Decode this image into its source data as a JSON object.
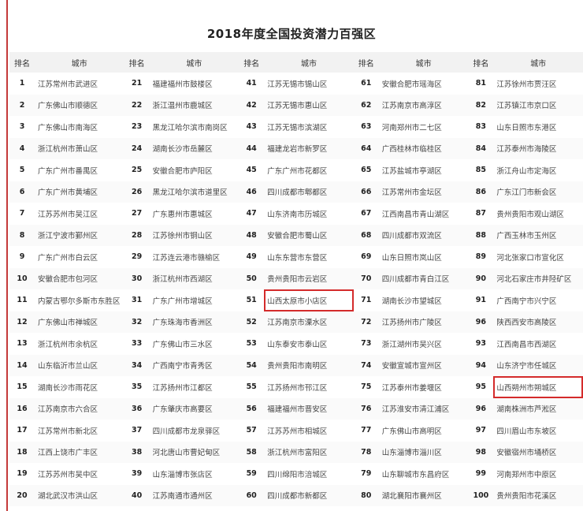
{
  "title": "2018年度全国投资潜力百强区",
  "headers": {
    "rank": "排名",
    "city": "城市"
  },
  "highlight_ranks": [
    51,
    95
  ],
  "rankings": [
    {
      "rank": 1,
      "name": "江苏常州市武进区"
    },
    {
      "rank": 2,
      "name": "广东佛山市顺德区"
    },
    {
      "rank": 3,
      "name": "广东佛山市南海区"
    },
    {
      "rank": 4,
      "name": "浙江杭州市萧山区"
    },
    {
      "rank": 5,
      "name": "广东广州市番禺区"
    },
    {
      "rank": 6,
      "name": "广东广州市黄埔区"
    },
    {
      "rank": 7,
      "name": "江苏苏州市吴江区"
    },
    {
      "rank": 8,
      "name": "浙江宁波市鄞州区"
    },
    {
      "rank": 9,
      "name": "广东广州市白云区"
    },
    {
      "rank": 10,
      "name": "安徽合肥市包河区"
    },
    {
      "rank": 11,
      "name": "内蒙古鄂尔多斯市东胜区"
    },
    {
      "rank": 12,
      "name": "广东佛山市禅城区"
    },
    {
      "rank": 13,
      "name": "浙江杭州市余杭区"
    },
    {
      "rank": 14,
      "name": "山东临沂市兰山区"
    },
    {
      "rank": 15,
      "name": "湖南长沙市雨花区"
    },
    {
      "rank": 16,
      "name": "江苏南京市六合区"
    },
    {
      "rank": 17,
      "name": "江苏常州市新北区"
    },
    {
      "rank": 18,
      "name": "江西上饶市广丰区"
    },
    {
      "rank": 19,
      "name": "江苏苏州市吴中区"
    },
    {
      "rank": 20,
      "name": "湖北武汉市洪山区"
    },
    {
      "rank": 21,
      "name": "福建福州市鼓楼区"
    },
    {
      "rank": 22,
      "name": "浙江温州市鹿城区"
    },
    {
      "rank": 23,
      "name": "黑龙江哈尔滨市南岗区"
    },
    {
      "rank": 24,
      "name": "湖南长沙市岳麓区"
    },
    {
      "rank": 25,
      "name": "安徽合肥市庐阳区"
    },
    {
      "rank": 26,
      "name": "黑龙江哈尔滨市道里区"
    },
    {
      "rank": 27,
      "name": "广东惠州市惠城区"
    },
    {
      "rank": 28,
      "name": "江苏徐州市铜山区"
    },
    {
      "rank": 29,
      "name": "江苏连云港市赣榆区"
    },
    {
      "rank": 30,
      "name": "浙江杭州市西湖区"
    },
    {
      "rank": 31,
      "name": "广东广州市增城区"
    },
    {
      "rank": 32,
      "name": "广东珠海市香洲区"
    },
    {
      "rank": 33,
      "name": "广东佛山市三水区"
    },
    {
      "rank": 34,
      "name": "广西南宁市青秀区"
    },
    {
      "rank": 35,
      "name": "江苏扬州市江都区"
    },
    {
      "rank": 36,
      "name": "广东肇庆市高要区"
    },
    {
      "rank": 37,
      "name": "四川成都市龙泉驿区"
    },
    {
      "rank": 38,
      "name": "河北唐山市曹妃甸区"
    },
    {
      "rank": 39,
      "name": "山东淄博市张店区"
    },
    {
      "rank": 40,
      "name": "江苏南通市通州区"
    },
    {
      "rank": 41,
      "name": "江苏无锡市锡山区"
    },
    {
      "rank": 42,
      "name": "江苏无锡市惠山区"
    },
    {
      "rank": 43,
      "name": "江苏无锡市滨湖区"
    },
    {
      "rank": 44,
      "name": "福建龙岩市新罗区"
    },
    {
      "rank": 45,
      "name": "广东广州市花都区"
    },
    {
      "rank": 46,
      "name": "四川成都市郫都区"
    },
    {
      "rank": 47,
      "name": "山东济南市历城区"
    },
    {
      "rank": 48,
      "name": "安徽合肥市蜀山区"
    },
    {
      "rank": 49,
      "name": "山东东营市东营区"
    },
    {
      "rank": 50,
      "name": "贵州贵阳市云岩区"
    },
    {
      "rank": 51,
      "name": "山西太原市小店区"
    },
    {
      "rank": 52,
      "name": "江苏南京市溧水区"
    },
    {
      "rank": 53,
      "name": "山东泰安市泰山区"
    },
    {
      "rank": 54,
      "name": "贵州贵阳市南明区"
    },
    {
      "rank": 55,
      "name": "江苏扬州市邗江区"
    },
    {
      "rank": 56,
      "name": "福建福州市晋安区"
    },
    {
      "rank": 57,
      "name": "江苏苏州市相城区"
    },
    {
      "rank": 58,
      "name": "浙江杭州市富阳区"
    },
    {
      "rank": 59,
      "name": "四川绵阳市涪城区"
    },
    {
      "rank": 60,
      "name": "四川成都市新都区"
    },
    {
      "rank": 61,
      "name": "安徽合肥市瑶海区"
    },
    {
      "rank": 62,
      "name": "江苏南京市高淳区"
    },
    {
      "rank": 63,
      "name": "河南郑州市二七区"
    },
    {
      "rank": 64,
      "name": "广西桂林市临桂区"
    },
    {
      "rank": 65,
      "name": "江苏盐城市亭湖区"
    },
    {
      "rank": 66,
      "name": "江苏常州市金坛区"
    },
    {
      "rank": 67,
      "name": "江西南昌市青山湖区"
    },
    {
      "rank": 68,
      "name": "四川成都市双流区"
    },
    {
      "rank": 69,
      "name": "山东日照市岚山区"
    },
    {
      "rank": 70,
      "name": "四川成都市青白江区"
    },
    {
      "rank": 71,
      "name": "湖南长沙市望城区"
    },
    {
      "rank": 72,
      "name": "江苏扬州市广陵区"
    },
    {
      "rank": 73,
      "name": "浙江湖州市吴兴区"
    },
    {
      "rank": 74,
      "name": "安徽宣城市宣州区"
    },
    {
      "rank": 75,
      "name": "江苏泰州市姜堰区"
    },
    {
      "rank": 76,
      "name": "江苏淮安市清江浦区"
    },
    {
      "rank": 77,
      "name": "广东佛山市高明区"
    },
    {
      "rank": 78,
      "name": "山东淄博市淄川区"
    },
    {
      "rank": 79,
      "name": "山东聊城市东昌府区"
    },
    {
      "rank": 80,
      "name": "湖北襄阳市襄州区"
    },
    {
      "rank": 81,
      "name": "江苏徐州市贾汪区"
    },
    {
      "rank": 82,
      "name": "江苏镇江市京口区"
    },
    {
      "rank": 83,
      "name": "山东日照市东港区"
    },
    {
      "rank": 84,
      "name": "江苏泰州市海陵区"
    },
    {
      "rank": 85,
      "name": "浙江舟山市定海区"
    },
    {
      "rank": 86,
      "name": "广东江门市新会区"
    },
    {
      "rank": 87,
      "name": "贵州贵阳市观山湖区"
    },
    {
      "rank": 88,
      "name": "广西玉林市玉州区"
    },
    {
      "rank": 89,
      "name": "河北张家口市宣化区"
    },
    {
      "rank": 90,
      "name": "河北石家庄市井陉矿区"
    },
    {
      "rank": 91,
      "name": "广西南宁市兴宁区"
    },
    {
      "rank": 96,
      "name": "陕西西安市高陵区"
    },
    {
      "rank": 93,
      "name": "江西南昌市西湖区"
    },
    {
      "rank": 94,
      "name": "山东济宁市任城区"
    },
    {
      "rank": 95,
      "name": "山西朔州市朔城区"
    },
    {
      "rank": 96,
      "name": "湖南株洲市芦淞区"
    },
    {
      "rank": 97,
      "name": "四川眉山市东坡区"
    },
    {
      "rank": 98,
      "name": "安徽宿州市埇桥区"
    },
    {
      "rank": 99,
      "name": "河南郑州市中原区"
    },
    {
      "rank": 100,
      "name": "贵州贵阳市花溪区"
    }
  ]
}
